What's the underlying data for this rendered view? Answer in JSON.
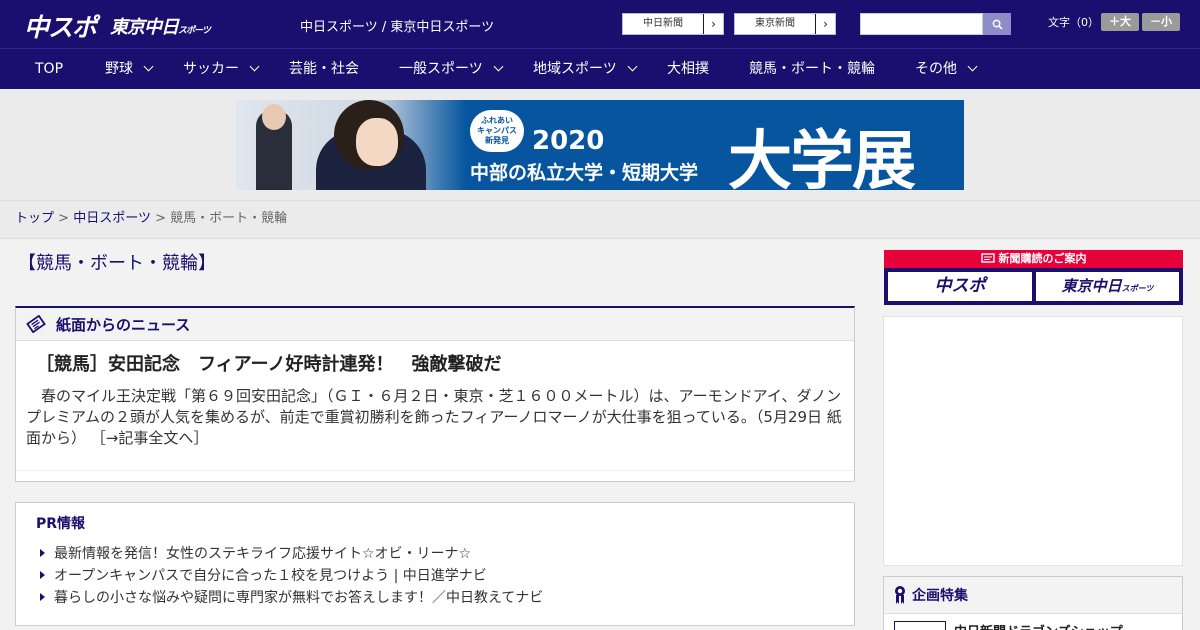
{
  "header": {
    "logo_main": "中スポ",
    "logo_tokyo": "東京中日",
    "logo_tokyo_small": "スポーツ",
    "site_title": "中日スポーツ / 東京中日スポーツ",
    "links": [
      {
        "label": "中日新聞",
        "arrow": "›"
      },
      {
        "label": "東京新聞",
        "arrow": "›"
      }
    ],
    "search": {
      "placeholder": "",
      "icon": "search-icon"
    },
    "font_size_label": "文字（0）",
    "font_larger": "＋大",
    "font_smaller": "－小"
  },
  "nav": {
    "items": [
      {
        "label": "TOP",
        "dropdown": false
      },
      {
        "label": "野球",
        "dropdown": true
      },
      {
        "label": "サッカー",
        "dropdown": true
      },
      {
        "label": "芸能・社会",
        "dropdown": false
      },
      {
        "label": "一般スポーツ",
        "dropdown": true
      },
      {
        "label": "地域スポーツ",
        "dropdown": true
      },
      {
        "label": "大相撲",
        "dropdown": false
      },
      {
        "label": "競馬・ボート・競輪",
        "dropdown": false
      },
      {
        "label": "その他",
        "dropdown": true
      }
    ]
  },
  "banner": {
    "badge": [
      "ふれあい",
      "キャンパス",
      "新発見"
    ],
    "year": "2020",
    "subtitle": "中部の私立大学・短期大学",
    "headline": "大学展"
  },
  "breadcrumb": {
    "items": [
      "トップ",
      "中日スポーツ"
    ],
    "separator": ">",
    "current": "競馬・ボート・競輪"
  },
  "page": {
    "heading": "【競馬・ボート・競輪】"
  },
  "news": {
    "section_title": "紙面からのニュース",
    "article_title": "［競馬］安田記念　フィアーノ好時計連発！　強敵撃破だ",
    "article_body": "　春のマイル王決定戦「第６９回安田記念」（ＧＩ・６月２日・東京・芝１６００メートル）は、アーモンドアイ、ダノンプレミアムの２頭が人気を集めるが、前走で重賞初勝利を飾ったフィアーノロマーノが大仕事を狙っている。（5月29日 紙面から）",
    "more_link": "［→記事全文へ］"
  },
  "pr": {
    "title": "PR情報",
    "items": [
      "最新情報を発信！女性のステキライフ応援サイト☆オビ・リーナ☆",
      "オープンキャンパスで自分に合った１校を見つけよう | 中日進学ナビ",
      "暮らしの小さな悩みや疑問に専門家が無料でお答えします！／中日教えてナビ"
    ]
  },
  "sidebar": {
    "subscription_header": "新聞購読のご案内",
    "subscription_buttons": [
      "中スポ",
      "東京中日"
    ],
    "subscription_small": "スポーツ",
    "feature_title": "企画特集",
    "feature_item": "中日新聞ドラゴンズショップ"
  },
  "colors": {
    "brand_navy": "#1a0f6e",
    "accent_red": "#e8003a",
    "banner_blue": "#06559e"
  }
}
